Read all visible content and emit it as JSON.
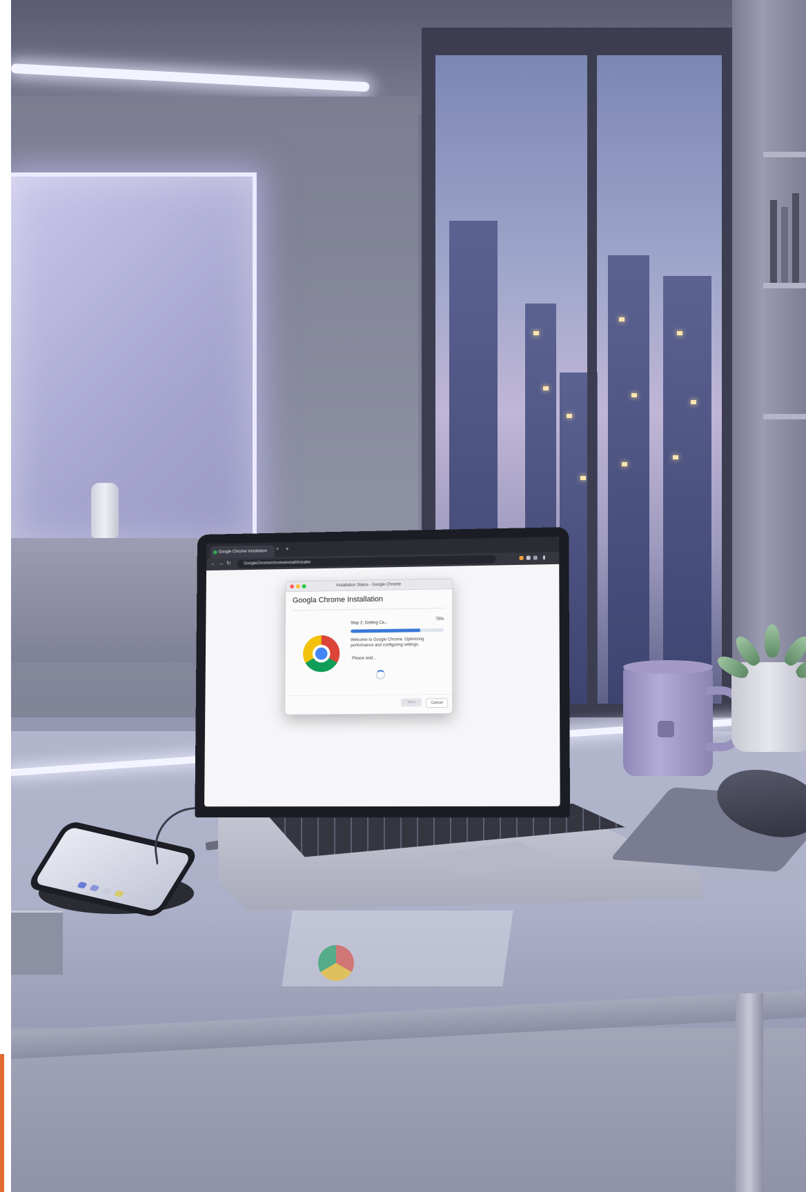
{
  "browser": {
    "tab_title": "Google Chrome Installation",
    "tab_close": "×",
    "new_tab": "+",
    "url": "GoogleChrome/chromeinstall/installer",
    "nav_back": "←",
    "nav_forward": "→",
    "nav_reload": "↻"
  },
  "dialog": {
    "window_title": "Installation Status - Google Chrome",
    "heading": "Googla Chrome Installation",
    "step_text": "Step 2: Getting Ca...",
    "percent_text": "75%",
    "progress": 0.75,
    "message": "Welcome to Google Chrome. Optimizing performance and configuring settings.",
    "wait_text": "Please wait...",
    "next_button": "Next",
    "cancel_button": "Cancel"
  },
  "colors": {
    "accent_blue": "#3a78d8",
    "chrome_red": "#db4437",
    "chrome_yellow": "#f4c20d",
    "chrome_green": "#0f9d58",
    "chrome_blue": "#4285f4"
  }
}
